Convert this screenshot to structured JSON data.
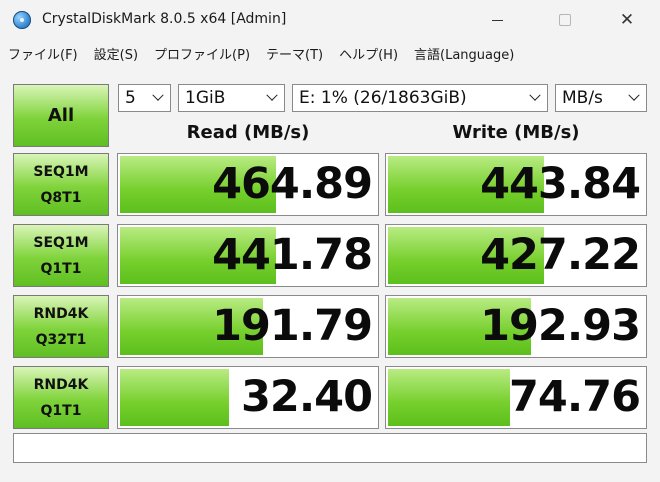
{
  "window": {
    "title": "CrystalDiskMark 8.0.5 x64 [Admin]",
    "controls": {
      "minimize": "",
      "maximize": "",
      "close": "✕"
    }
  },
  "menu": [
    {
      "id": "file",
      "label": "ファイル(F)"
    },
    {
      "id": "settings",
      "label": "設定(S)"
    },
    {
      "id": "profile",
      "label": "プロファイル(P)"
    },
    {
      "id": "theme",
      "label": "テーマ(T)"
    },
    {
      "id": "help",
      "label": "ヘルプ(H)"
    },
    {
      "id": "language",
      "label": "言語(Language)"
    }
  ],
  "controls": {
    "all_label": "All",
    "count_value": "5",
    "size_value": "1GiB",
    "drive_value": "E: 1% (26/1863GiB)",
    "unit_value": "MB/s"
  },
  "headers": {
    "read": "Read (MB/s)",
    "write": "Write (MB/s)"
  },
  "tests": [
    {
      "line1": "SEQ1M",
      "line2": "Q8T1",
      "read": "464.89",
      "write": "443.84",
      "read_fill": 0.6,
      "write_fill": 0.6
    },
    {
      "line1": "SEQ1M",
      "line2": "Q1T1",
      "read": "441.78",
      "write": "427.22",
      "read_fill": 0.6,
      "write_fill": 0.6
    },
    {
      "line1": "RND4K",
      "line2": "Q32T1",
      "read": "191.79",
      "write": "192.93",
      "read_fill": 0.55,
      "write_fill": 0.55
    },
    {
      "line1": "RND4K",
      "line2": "Q1T1",
      "read": "32.40",
      "write": "74.76",
      "read_fill": 0.42,
      "write_fill": 0.47
    }
  ],
  "status": ""
}
